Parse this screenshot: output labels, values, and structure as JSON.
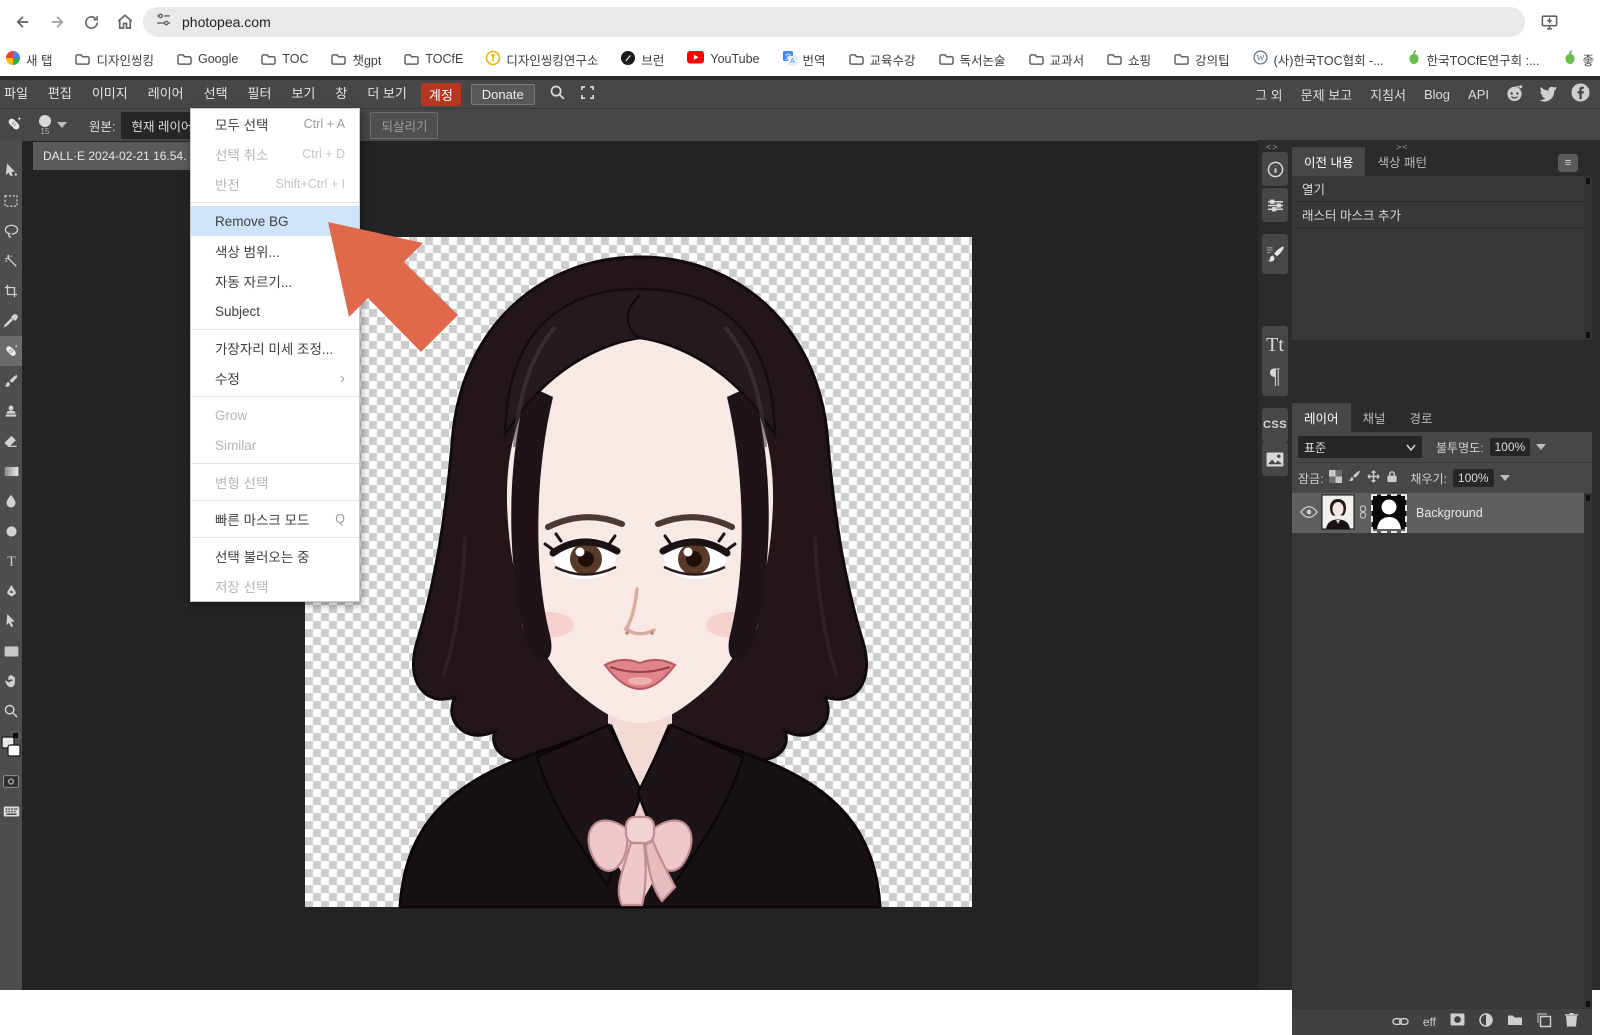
{
  "browser": {
    "url": "photopea.com",
    "bookmarks": [
      {
        "label": "새 탭",
        "icon": "colorful-logo"
      },
      {
        "label": "디자인씽킹",
        "icon": "folder"
      },
      {
        "label": "Google",
        "icon": "folder"
      },
      {
        "label": "TOC",
        "icon": "folder"
      },
      {
        "label": "챗gpt",
        "icon": "folder"
      },
      {
        "label": "TOCfE",
        "icon": "folder"
      },
      {
        "label": "디자인씽킹연구소",
        "icon": "yellow-coin"
      },
      {
        "label": "브런",
        "icon": "brunch-black-circle"
      },
      {
        "label": "YouTube",
        "icon": "youtube"
      },
      {
        "label": "번역",
        "icon": "google-translate"
      },
      {
        "label": "교육수강",
        "icon": "folder"
      },
      {
        "label": "독서논술",
        "icon": "folder"
      },
      {
        "label": "교과서",
        "icon": "folder"
      },
      {
        "label": "쇼핑",
        "icon": "folder"
      },
      {
        "label": "강의팁",
        "icon": "folder"
      },
      {
        "label": "(사)한국TOC협회 -...",
        "icon": "wordpress"
      },
      {
        "label": "한국TOCfE연구회 :...",
        "icon": "green-apple"
      },
      {
        "label": "좋",
        "icon": "green-apple"
      }
    ]
  },
  "menubar": {
    "items": [
      {
        "label": "파일"
      },
      {
        "label": "편집"
      },
      {
        "label": "이미지"
      },
      {
        "label": "레이어"
      },
      {
        "label": "선택"
      },
      {
        "label": "필터"
      },
      {
        "label": "보기"
      },
      {
        "label": "창"
      },
      {
        "label": "더 보기"
      }
    ],
    "account": "계정",
    "donate": "Donate",
    "right_items": [
      {
        "label": "그 외"
      },
      {
        "label": "문제 보고"
      },
      {
        "label": "지침서"
      },
      {
        "label": "Blog"
      },
      {
        "label": "API"
      }
    ]
  },
  "options": {
    "brush_size": "15",
    "source_label": "원본:",
    "source_value": "현재 레이어",
    "revert": "되살리기"
  },
  "doc_tab": "DALL·E 2024-02-21 16.54.",
  "menu": {
    "items": [
      {
        "label": "모두 선택",
        "shortcut": "Ctrl + A",
        "state": "normal"
      },
      {
        "label": "선택 취소",
        "shortcut": "Ctrl + D",
        "state": "disabled"
      },
      {
        "label": "반전",
        "shortcut": "Shift+Ctrl + I",
        "state": "disabled"
      },
      {
        "label": "Remove BG",
        "state": "highlighted"
      },
      {
        "label": "색상 범위...",
        "state": "normal"
      },
      {
        "label": "자동 자르기...",
        "state": "normal"
      },
      {
        "label": "Subject",
        "state": "normal"
      },
      {
        "label": "가장자리 미세 조정...",
        "state": "normal"
      },
      {
        "label": "수정",
        "submenu_arrow": "›",
        "state": "normal"
      },
      {
        "label": "Grow",
        "state": "disabled"
      },
      {
        "label": "Similar",
        "state": "disabled"
      },
      {
        "label": "변형 선택",
        "state": "disabled"
      },
      {
        "label": "빠른 마스크 모드",
        "shortcut": "Q",
        "state": "normal"
      },
      {
        "label": "선택 불러오는 중",
        "state": "normal"
      },
      {
        "label": "저장 선택",
        "state": "disabled"
      }
    ]
  },
  "panels": {
    "collapse_left": "<>",
    "collapse_right": "><",
    "history": {
      "tabs": [
        {
          "label": "이전 내용"
        },
        {
          "label": "색상 패턴"
        }
      ],
      "entries": [
        {
          "label": "열기"
        },
        {
          "label": "래스터 마스크 추가"
        }
      ]
    },
    "layers": {
      "tabs": [
        {
          "label": "레이어"
        },
        {
          "label": "채널"
        },
        {
          "label": "경로"
        }
      ],
      "blend_mode": "표준",
      "opacity_label": "불투명도:",
      "opacity_value": "100%",
      "lock_label": "잠금:",
      "fill_label": "채우기:",
      "fill_value": "100%",
      "layer_name": "Background",
      "eff_label": "eff"
    },
    "strip": {
      "text_icon": "Tt",
      "paragraph_icon": "¶",
      "css_icon": "CSS"
    }
  },
  "tools": {
    "type_glyph": "T"
  },
  "annotation": {
    "arrow_color": "#e0694b"
  },
  "colors": {
    "workspace": "#232323",
    "panel_dark": "#2b2b2b",
    "bar_gray": "#474747",
    "account_red": "#b6371f",
    "menu_highlight": "#cfe4f8"
  }
}
